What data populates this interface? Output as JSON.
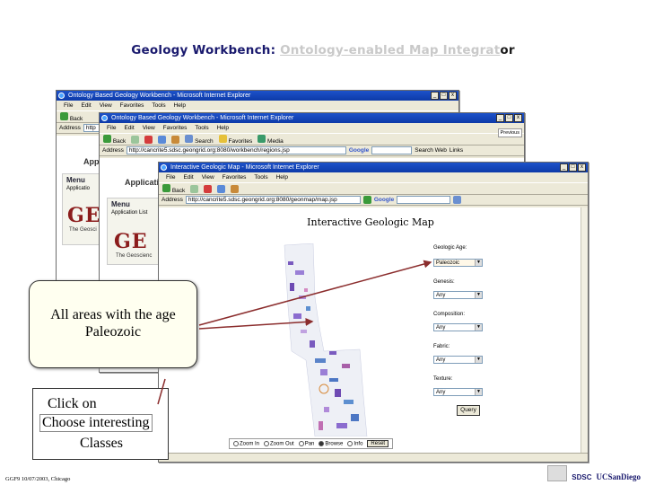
{
  "slide": {
    "title_part1": "Geology Workbench: ",
    "title_part2": "Ontology-enabled Map Integrat",
    "title_part3": "or",
    "footer": "GGF9 10/07/2003, Chicago",
    "logo_sdsc": "SDSC",
    "logo_ucsd": "UCSanDiego"
  },
  "window_back": {
    "title": "Ontology Based Geology Workbench - Microsoft Internet Explorer",
    "menu": [
      "File",
      "Edit",
      "View",
      "Favorites",
      "Tools",
      "Help"
    ],
    "back_label": "Back",
    "address_label": "Address",
    "address_value": "http",
    "page_heading": "Appl",
    "menu_heading": "Menu",
    "menu_item": "Applicatio",
    "logo_text": "GE",
    "logo_sub": "The Geosci"
  },
  "window_mid": {
    "title": "Ontology Based Geology Workbench - Microsoft Internet Explorer",
    "menu": [
      "File",
      "Edit",
      "View",
      "Favorites",
      "Tools",
      "Help"
    ],
    "back_label": "Back",
    "toolbar_search": "Search",
    "toolbar_favorites": "Favorites",
    "toolbar_media": "Media",
    "address_label": "Address",
    "address_value": "http://cancrite5.sdsc.geongrid.org:8080/workbench/regions.jsp",
    "google_label": "Google",
    "search_web": "Search Web",
    "links_label": "Links",
    "page_heading": "Applicatio",
    "menu_heading": "Menu",
    "menu_item": "Application List",
    "logo_text": "GE",
    "logo_sub": "The Geoscienc",
    "side_button": "Previous"
  },
  "window_front": {
    "title": "Interactive Geologic Map - Microsoft Internet Explorer",
    "menu": [
      "File",
      "Edit",
      "View",
      "Favorites",
      "Tools",
      "Help"
    ],
    "back_label": "Back",
    "address_label": "Address",
    "address_value": "http://cancrite5.sdsc.geongrid.org:8080/geonmap/map.jsp",
    "google_label": "Google",
    "page_title": "Interactive Geologic Map",
    "controls": {
      "age_label": "Geologic Age:",
      "age_value": "Paleozoic",
      "genesis_label": "Genesis:",
      "genesis_value": "Any",
      "composition_label": "Composition:",
      "composition_value": "Any",
      "fabric_label": "Fabric:",
      "fabric_value": "Any",
      "texture_label": "Texture:",
      "texture_value": "Any",
      "query_button": "Query"
    },
    "map_tools": {
      "zoom_in": "Zoom In",
      "zoom_out": "Zoom Out",
      "pan": "Pan",
      "browse": "Browse",
      "info": "Info",
      "reset": "Reset"
    }
  },
  "callouts": {
    "paleozoic": "All areas with the age Paleozoic",
    "click_line": "Click on",
    "choose_line": "Choose interesting",
    "classes_line": "Classes"
  }
}
